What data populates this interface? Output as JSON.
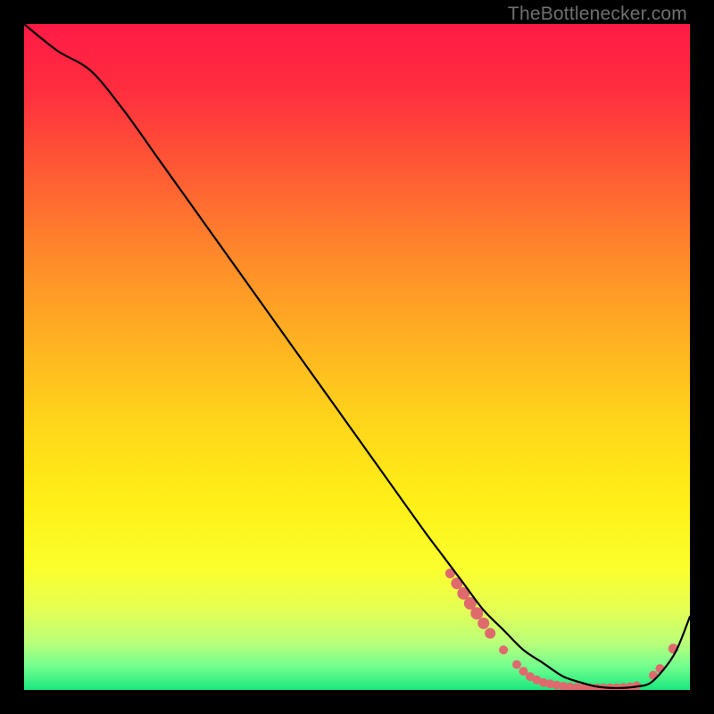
{
  "watermark": "TheBottlenecker.com",
  "gradient_stops": [
    {
      "offset": 0.0,
      "color": "#ff1a46"
    },
    {
      "offset": 0.1,
      "color": "#ff2e3f"
    },
    {
      "offset": 0.22,
      "color": "#ff5a34"
    },
    {
      "offset": 0.35,
      "color": "#ff8a2a"
    },
    {
      "offset": 0.48,
      "color": "#ffb321"
    },
    {
      "offset": 0.6,
      "color": "#ffd61a"
    },
    {
      "offset": 0.72,
      "color": "#fff017"
    },
    {
      "offset": 0.82,
      "color": "#fbff2e"
    },
    {
      "offset": 0.88,
      "color": "#e4ff55"
    },
    {
      "offset": 0.93,
      "color": "#b9ff7a"
    },
    {
      "offset": 0.965,
      "color": "#72ff8e"
    },
    {
      "offset": 1.0,
      "color": "#19e87e"
    }
  ],
  "chart_data": {
    "type": "line",
    "title": "",
    "xlabel": "",
    "ylabel": "",
    "xlim": [
      0,
      100
    ],
    "ylim": [
      0,
      100
    ],
    "series": [
      {
        "name": "bottleneck-curve",
        "x": [
          0,
          5,
          10,
          15,
          20,
          25,
          30,
          35,
          40,
          45,
          50,
          55,
          60,
          63,
          66,
          69,
          72,
          75,
          78,
          81,
          84,
          86,
          88,
          90,
          92,
          94,
          96,
          98,
          100
        ],
        "y": [
          100,
          96,
          93,
          87,
          80,
          73,
          66,
          59,
          52,
          45,
          38,
          31,
          24,
          20,
          16,
          12,
          9,
          6,
          4,
          2,
          1,
          0.5,
          0.3,
          0.3,
          0.5,
          1,
          3,
          6,
          11
        ]
      }
    ],
    "markers": {
      "name": "highlight-dots",
      "color": "#de6a6e",
      "points": [
        {
          "x": 64,
          "y": 17.5,
          "r": 5.5
        },
        {
          "x": 65,
          "y": 16,
          "r": 6.5
        },
        {
          "x": 66,
          "y": 14.5,
          "r": 7
        },
        {
          "x": 67,
          "y": 13,
          "r": 7
        },
        {
          "x": 68,
          "y": 11.5,
          "r": 7
        },
        {
          "x": 69,
          "y": 10,
          "r": 6.5
        },
        {
          "x": 70,
          "y": 8.5,
          "r": 6
        },
        {
          "x": 72,
          "y": 6,
          "r": 5
        },
        {
          "x": 74,
          "y": 3.8,
          "r": 5
        },
        {
          "x": 75,
          "y": 2.8,
          "r": 5
        },
        {
          "x": 76,
          "y": 2.0,
          "r": 5
        },
        {
          "x": 77,
          "y": 1.5,
          "r": 5
        },
        {
          "x": 78,
          "y": 1.1,
          "r": 5
        },
        {
          "x": 79,
          "y": 0.9,
          "r": 5
        },
        {
          "x": 80,
          "y": 0.7,
          "r": 5
        },
        {
          "x": 81,
          "y": 0.55,
          "r": 5
        },
        {
          "x": 82,
          "y": 0.45,
          "r": 5
        },
        {
          "x": 83,
          "y": 0.38,
          "r": 5
        },
        {
          "x": 84,
          "y": 0.34,
          "r": 5
        },
        {
          "x": 85,
          "y": 0.32,
          "r": 5
        },
        {
          "x": 86,
          "y": 0.3,
          "r": 5
        },
        {
          "x": 87,
          "y": 0.3,
          "r": 5
        },
        {
          "x": 88,
          "y": 0.3,
          "r": 5
        },
        {
          "x": 89,
          "y": 0.32,
          "r": 5
        },
        {
          "x": 90,
          "y": 0.36,
          "r": 5
        },
        {
          "x": 91,
          "y": 0.45,
          "r": 5
        },
        {
          "x": 92,
          "y": 0.6,
          "r": 5
        },
        {
          "x": 94.5,
          "y": 2.2,
          "r": 5
        },
        {
          "x": 95.5,
          "y": 3.2,
          "r": 5
        },
        {
          "x": 97.5,
          "y": 6.2,
          "r": 5.5
        }
      ]
    }
  }
}
